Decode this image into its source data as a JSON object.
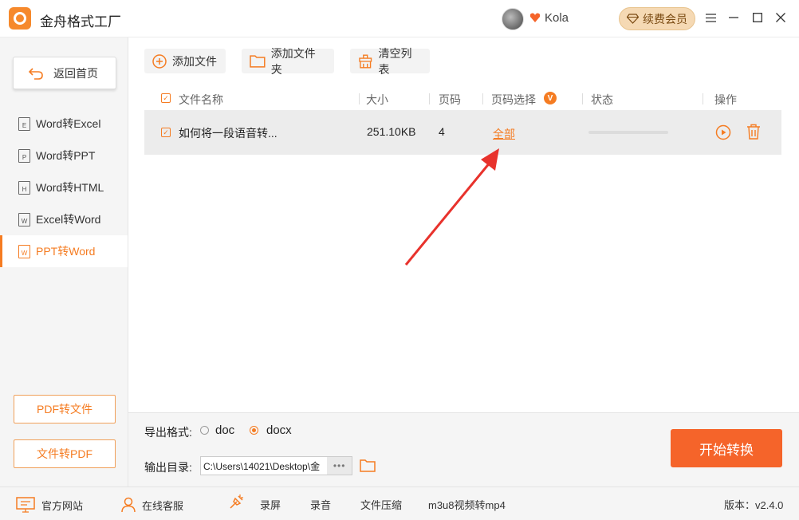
{
  "titlebar": {
    "app_title": "金舟格式工厂",
    "username": "Kola",
    "renew_label": "续费会员"
  },
  "sidebar": {
    "home_label": "返回首页",
    "items": [
      {
        "label": "Word转Excel",
        "icon": "word-doc-icon",
        "letter": "E"
      },
      {
        "label": "Word转PPT",
        "icon": "word-doc-icon",
        "letter": "P"
      },
      {
        "label": "Word转HTML",
        "icon": "word-doc-icon",
        "letter": "H"
      },
      {
        "label": "Excel转Word",
        "icon": "excel-doc-icon",
        "letter": "W"
      },
      {
        "label": "PPT转Word",
        "icon": "ppt-doc-icon",
        "letter": "W",
        "active": true
      }
    ],
    "pdf_to_file": "PDF转文件",
    "file_to_pdf": "文件转PDF"
  },
  "toolbar": {
    "add_file": "添加文件",
    "add_folder": "添加文件夹",
    "clear_list": "清空列表"
  },
  "table": {
    "headers": {
      "name": "文件名称",
      "size": "大小",
      "pages": "页码",
      "page_select": "页码选择",
      "status": "状态",
      "action": "操作"
    },
    "vip_badge": "V",
    "rows": [
      {
        "name": "如何将一段语音转...",
        "size": "251.10KB",
        "pages": "4",
        "page_select": "全部",
        "progress": 0
      }
    ]
  },
  "output": {
    "format_label": "导出格式:",
    "formats": [
      "doc",
      "docx"
    ],
    "selected_format": "docx",
    "dir_label": "输出目录:",
    "dir_value": "C:\\Users\\14021\\Desktop\\金",
    "more": "•••",
    "start_label": "开始转换"
  },
  "statusbar": {
    "website": "官方网站",
    "support": "在线客服",
    "record_screen": "录屏",
    "record_audio": "录音",
    "compress": "文件压缩",
    "m3u8": "m3u8视频转mp4",
    "version": "版本：v2.4.0"
  },
  "colors": {
    "accent": "#f57c22",
    "start_button": "#f5642a",
    "annotation_arrow": "#e8322c"
  }
}
